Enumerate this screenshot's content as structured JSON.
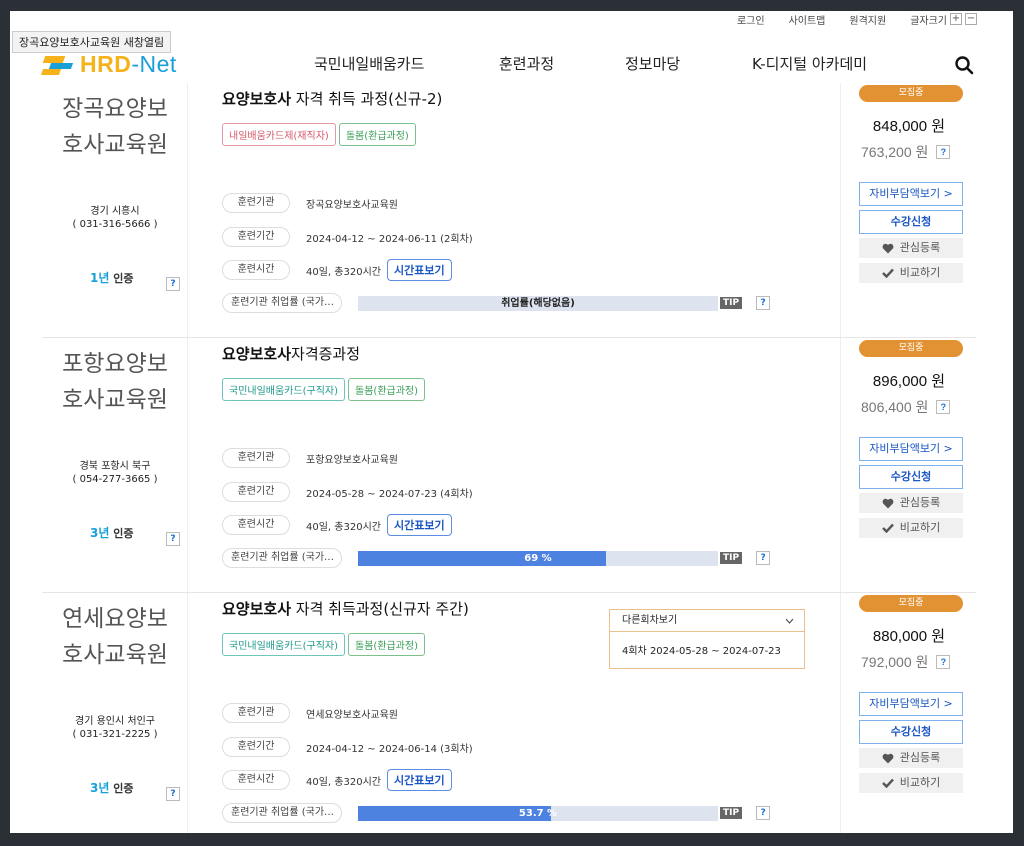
{
  "tooltip": "장곡요양보호사교육원 새창열림",
  "util": {
    "login": "로그인",
    "sitemap": "사이트맵",
    "remote": "원격지원",
    "fontsize": "글자크기",
    "plus": "+",
    "minus": "−"
  },
  "logo": {
    "hrd": "HRD",
    "dash": "-",
    "net": "Net"
  },
  "gnb": [
    "국민내일배움카드",
    "훈련과정",
    "정보마당",
    "K-디지털 아카데미"
  ],
  "labels": {
    "institution": "훈련기관",
    "period": "훈련기간",
    "hours": "훈련시간",
    "employment": "훈련기관 취업률 (국가…",
    "schedule": "시간표보기",
    "tip": "TIP",
    "status": "모집중",
    "self_pay": "자비부담액보기 >",
    "apply": "수강신청",
    "wishlist": "관심등록",
    "compare": "비교하기",
    "question": "?",
    "cert_suffix": "인증"
  },
  "courses": [
    {
      "org_name": "장곡요양보호사교육원",
      "org_line1": "장곡요양보",
      "org_line2": "호사교육원",
      "addr": "경기 시흥시",
      "phone": "( 031-316-5666 )",
      "cert_years": "1년",
      "title_bold": "요양보호사",
      "title_rest": " 자격 취득 과정(신규-2)",
      "tags": [
        {
          "text": "내일배움카드제(재직자)",
          "color": "red"
        },
        {
          "text": "돌봄(환급과정)",
          "color": "green"
        }
      ],
      "institution": "장곡요양보호사교육원",
      "period": "2024-04-12 ~ 2024-06-11 (2회차)",
      "hours": "40일, 총320시간",
      "employment_rate": 0,
      "employment_label": "취업률(해당없음)",
      "price": "848,000 원",
      "price_support": "763,200 원"
    },
    {
      "org_name": "포항요양보호사교육원",
      "org_line1": "포항요양보",
      "org_line2": "호사교육원",
      "addr": "경북 포항시 북구",
      "phone": "( 054-277-3665 )",
      "cert_years": "3년",
      "title_bold": "요양보호사",
      "title_rest": "자격증과정",
      "tags": [
        {
          "text": "국민내일배움카드(구직자)",
          "color": "teal"
        },
        {
          "text": "돌봄(환급과정)",
          "color": "green"
        }
      ],
      "institution": "포항요양보호사교육원",
      "period": "2024-05-28 ~ 2024-07-23 (4회차)",
      "hours": "40일, 총320시간",
      "employment_rate": 69,
      "employment_label": "69 %",
      "price": "896,000 원",
      "price_support": "806,400 원"
    },
    {
      "org_name": "연세요양보호사교육원",
      "org_line1": "연세요양보",
      "org_line2": "호사교육원",
      "addr": "경기 용인시 처인구",
      "phone": "( 031-321-2225 )",
      "cert_years": "3년",
      "title_bold": "요양보호사",
      "title_rest": " 자격 취득과정(신규자 주간)",
      "tags": [
        {
          "text": "국민내일배움카드(구직자)",
          "color": "teal"
        },
        {
          "text": "돌봄(환급과정)",
          "color": "green"
        }
      ],
      "institution": "연세요양보호사교육원",
      "period": "2024-04-12 ~ 2024-06-14 (3회차)",
      "hours": "40일, 총320시간",
      "employment_rate": 53.7,
      "employment_label": "53.7 %",
      "price": "880,000 원",
      "price_support": "792,000 원"
    }
  ],
  "dropdown": {
    "label": "다른회차보기",
    "option": "4회차 2024-05-28 ~ 2024-07-23"
  },
  "colors": {
    "brand_orange": "#f6b21a",
    "brand_blue": "#1aa0d8",
    "badge": "#e39233",
    "bar_fill": "#4e82e0"
  }
}
